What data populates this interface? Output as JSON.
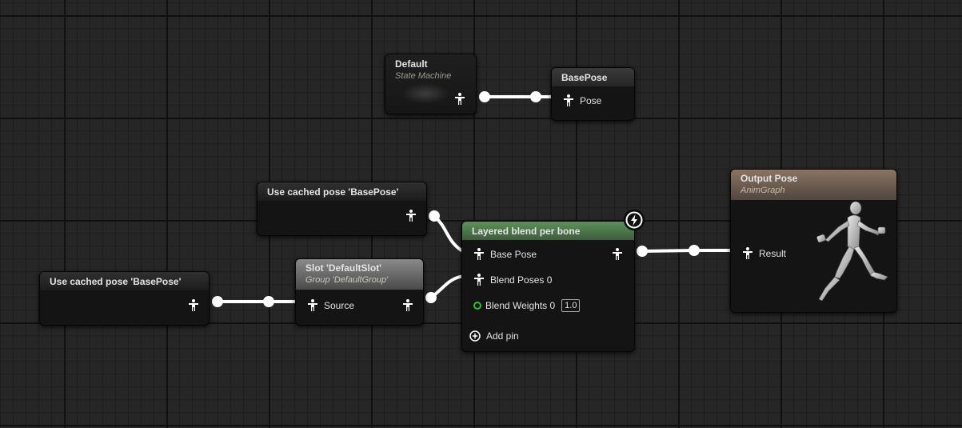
{
  "nodes": {
    "state_machine": {
      "title": "Default",
      "subtitle": "State Machine"
    },
    "save_cached_pose": {
      "title": "BasePose",
      "pin_pose": "Pose"
    },
    "use_cached_pose_top": {
      "title": "Use cached pose 'BasePose'"
    },
    "use_cached_pose_left": {
      "title": "Use cached pose 'BasePose'"
    },
    "slot": {
      "title": "Slot 'DefaultSlot'",
      "subtitle": "Group 'DefaultGroup'",
      "pin_source": "Source"
    },
    "layered_blend": {
      "title": "Layered blend per bone",
      "pin_base_pose": "Base Pose",
      "pin_blend_poses": "Blend Poses 0",
      "pin_blend_weights": "Blend Weights 0",
      "blend_weights_value": "1.0",
      "add_pin": "Add pin"
    },
    "output_pose": {
      "title": "Output Pose",
      "subtitle": "AnimGraph",
      "pin_result": "Result"
    }
  },
  "colors": {
    "pose_pin": "#ffffff",
    "float_pin": "#2dc32d",
    "layered_blend_header": "#4e7a4c",
    "output_pose_header": "#6e5e52"
  },
  "icons": {
    "pose_pin": "pose-figure-icon",
    "fast_path": "lightning-icon",
    "add_pin": "plus-circle-icon",
    "float_pin": "circle-pin-icon"
  }
}
